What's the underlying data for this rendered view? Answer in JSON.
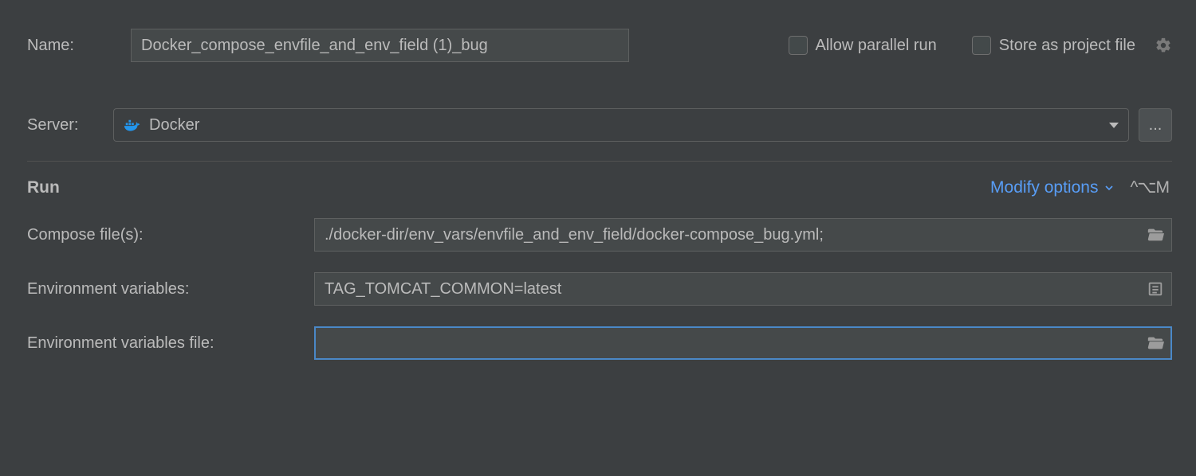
{
  "header": {
    "name_label": "Name:",
    "name_value": "Docker_compose_envfile_and_env_field (1)_bug",
    "allow_parallel_label": "Allow parallel run",
    "store_project_label": "Store as project file"
  },
  "server": {
    "label": "Server:",
    "selected": "Docker",
    "more_label": "..."
  },
  "run": {
    "title": "Run",
    "modify_label": "Modify options",
    "shortcut_glyph": "^⌥M",
    "fields": {
      "compose_files": {
        "label": "Compose file(s):",
        "value": "./docker-dir/env_vars/envfile_and_env_field/docker-compose_bug.yml;"
      },
      "env_vars": {
        "label": "Environment variables:",
        "value": "TAG_TOMCAT_COMMON=latest"
      },
      "env_vars_file": {
        "label": "Environment variables file:",
        "value": ""
      }
    }
  }
}
